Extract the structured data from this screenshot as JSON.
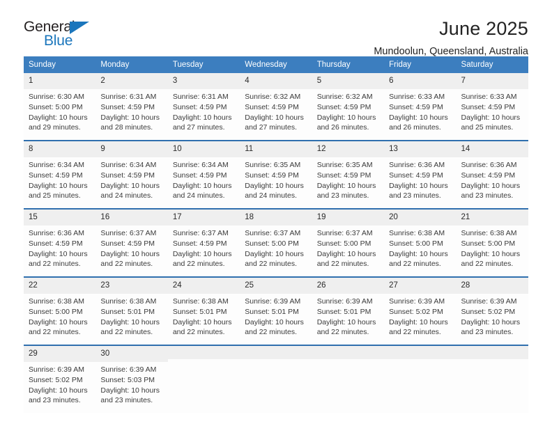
{
  "brand": {
    "name_part1": "General",
    "name_part2": "Blue",
    "accent_color": "#1b76bc",
    "triangle_icon": "triangle-icon"
  },
  "header": {
    "month_title": "June 2025",
    "location": "Mundoolun, Queensland, Australia"
  },
  "calendar": {
    "header_bg": "#3c7ebf",
    "week_divider_color": "#2f6fae",
    "daynum_bg": "#efefef",
    "weekdays": [
      "Sunday",
      "Monday",
      "Tuesday",
      "Wednesday",
      "Thursday",
      "Friday",
      "Saturday"
    ],
    "weeks": [
      [
        {
          "day": "1",
          "sunrise": "Sunrise: 6:30 AM",
          "sunset": "Sunset: 5:00 PM",
          "daylight_line1": "Daylight: 10 hours",
          "daylight_line2": "and 29 minutes."
        },
        {
          "day": "2",
          "sunrise": "Sunrise: 6:31 AM",
          "sunset": "Sunset: 4:59 PM",
          "daylight_line1": "Daylight: 10 hours",
          "daylight_line2": "and 28 minutes."
        },
        {
          "day": "3",
          "sunrise": "Sunrise: 6:31 AM",
          "sunset": "Sunset: 4:59 PM",
          "daylight_line1": "Daylight: 10 hours",
          "daylight_line2": "and 27 minutes."
        },
        {
          "day": "4",
          "sunrise": "Sunrise: 6:32 AM",
          "sunset": "Sunset: 4:59 PM",
          "daylight_line1": "Daylight: 10 hours",
          "daylight_line2": "and 27 minutes."
        },
        {
          "day": "5",
          "sunrise": "Sunrise: 6:32 AM",
          "sunset": "Sunset: 4:59 PM",
          "daylight_line1": "Daylight: 10 hours",
          "daylight_line2": "and 26 minutes."
        },
        {
          "day": "6",
          "sunrise": "Sunrise: 6:33 AM",
          "sunset": "Sunset: 4:59 PM",
          "daylight_line1": "Daylight: 10 hours",
          "daylight_line2": "and 26 minutes."
        },
        {
          "day": "7",
          "sunrise": "Sunrise: 6:33 AM",
          "sunset": "Sunset: 4:59 PM",
          "daylight_line1": "Daylight: 10 hours",
          "daylight_line2": "and 25 minutes."
        }
      ],
      [
        {
          "day": "8",
          "sunrise": "Sunrise: 6:34 AM",
          "sunset": "Sunset: 4:59 PM",
          "daylight_line1": "Daylight: 10 hours",
          "daylight_line2": "and 25 minutes."
        },
        {
          "day": "9",
          "sunrise": "Sunrise: 6:34 AM",
          "sunset": "Sunset: 4:59 PM",
          "daylight_line1": "Daylight: 10 hours",
          "daylight_line2": "and 24 minutes."
        },
        {
          "day": "10",
          "sunrise": "Sunrise: 6:34 AM",
          "sunset": "Sunset: 4:59 PM",
          "daylight_line1": "Daylight: 10 hours",
          "daylight_line2": "and 24 minutes."
        },
        {
          "day": "11",
          "sunrise": "Sunrise: 6:35 AM",
          "sunset": "Sunset: 4:59 PM",
          "daylight_line1": "Daylight: 10 hours",
          "daylight_line2": "and 24 minutes."
        },
        {
          "day": "12",
          "sunrise": "Sunrise: 6:35 AM",
          "sunset": "Sunset: 4:59 PM",
          "daylight_line1": "Daylight: 10 hours",
          "daylight_line2": "and 23 minutes."
        },
        {
          "day": "13",
          "sunrise": "Sunrise: 6:36 AM",
          "sunset": "Sunset: 4:59 PM",
          "daylight_line1": "Daylight: 10 hours",
          "daylight_line2": "and 23 minutes."
        },
        {
          "day": "14",
          "sunrise": "Sunrise: 6:36 AM",
          "sunset": "Sunset: 4:59 PM",
          "daylight_line1": "Daylight: 10 hours",
          "daylight_line2": "and 23 minutes."
        }
      ],
      [
        {
          "day": "15",
          "sunrise": "Sunrise: 6:36 AM",
          "sunset": "Sunset: 4:59 PM",
          "daylight_line1": "Daylight: 10 hours",
          "daylight_line2": "and 22 minutes."
        },
        {
          "day": "16",
          "sunrise": "Sunrise: 6:37 AM",
          "sunset": "Sunset: 4:59 PM",
          "daylight_line1": "Daylight: 10 hours",
          "daylight_line2": "and 22 minutes."
        },
        {
          "day": "17",
          "sunrise": "Sunrise: 6:37 AM",
          "sunset": "Sunset: 4:59 PM",
          "daylight_line1": "Daylight: 10 hours",
          "daylight_line2": "and 22 minutes."
        },
        {
          "day": "18",
          "sunrise": "Sunrise: 6:37 AM",
          "sunset": "Sunset: 5:00 PM",
          "daylight_line1": "Daylight: 10 hours",
          "daylight_line2": "and 22 minutes."
        },
        {
          "day": "19",
          "sunrise": "Sunrise: 6:37 AM",
          "sunset": "Sunset: 5:00 PM",
          "daylight_line1": "Daylight: 10 hours",
          "daylight_line2": "and 22 minutes."
        },
        {
          "day": "20",
          "sunrise": "Sunrise: 6:38 AM",
          "sunset": "Sunset: 5:00 PM",
          "daylight_line1": "Daylight: 10 hours",
          "daylight_line2": "and 22 minutes."
        },
        {
          "day": "21",
          "sunrise": "Sunrise: 6:38 AM",
          "sunset": "Sunset: 5:00 PM",
          "daylight_line1": "Daylight: 10 hours",
          "daylight_line2": "and 22 minutes."
        }
      ],
      [
        {
          "day": "22",
          "sunrise": "Sunrise: 6:38 AM",
          "sunset": "Sunset: 5:00 PM",
          "daylight_line1": "Daylight: 10 hours",
          "daylight_line2": "and 22 minutes."
        },
        {
          "day": "23",
          "sunrise": "Sunrise: 6:38 AM",
          "sunset": "Sunset: 5:01 PM",
          "daylight_line1": "Daylight: 10 hours",
          "daylight_line2": "and 22 minutes."
        },
        {
          "day": "24",
          "sunrise": "Sunrise: 6:38 AM",
          "sunset": "Sunset: 5:01 PM",
          "daylight_line1": "Daylight: 10 hours",
          "daylight_line2": "and 22 minutes."
        },
        {
          "day": "25",
          "sunrise": "Sunrise: 6:39 AM",
          "sunset": "Sunset: 5:01 PM",
          "daylight_line1": "Daylight: 10 hours",
          "daylight_line2": "and 22 minutes."
        },
        {
          "day": "26",
          "sunrise": "Sunrise: 6:39 AM",
          "sunset": "Sunset: 5:01 PM",
          "daylight_line1": "Daylight: 10 hours",
          "daylight_line2": "and 22 minutes."
        },
        {
          "day": "27",
          "sunrise": "Sunrise: 6:39 AM",
          "sunset": "Sunset: 5:02 PM",
          "daylight_line1": "Daylight: 10 hours",
          "daylight_line2": "and 22 minutes."
        },
        {
          "day": "28",
          "sunrise": "Sunrise: 6:39 AM",
          "sunset": "Sunset: 5:02 PM",
          "daylight_line1": "Daylight: 10 hours",
          "daylight_line2": "and 23 minutes."
        }
      ],
      [
        {
          "day": "29",
          "sunrise": "Sunrise: 6:39 AM",
          "sunset": "Sunset: 5:02 PM",
          "daylight_line1": "Daylight: 10 hours",
          "daylight_line2": "and 23 minutes."
        },
        {
          "day": "30",
          "sunrise": "Sunrise: 6:39 AM",
          "sunset": "Sunset: 5:03 PM",
          "daylight_line1": "Daylight: 10 hours",
          "daylight_line2": "and 23 minutes."
        },
        {
          "day": "",
          "sunrise": "",
          "sunset": "",
          "daylight_line1": "",
          "daylight_line2": ""
        },
        {
          "day": "",
          "sunrise": "",
          "sunset": "",
          "daylight_line1": "",
          "daylight_line2": ""
        },
        {
          "day": "",
          "sunrise": "",
          "sunset": "",
          "daylight_line1": "",
          "daylight_line2": ""
        },
        {
          "day": "",
          "sunrise": "",
          "sunset": "",
          "daylight_line1": "",
          "daylight_line2": ""
        },
        {
          "day": "",
          "sunrise": "",
          "sunset": "",
          "daylight_line1": "",
          "daylight_line2": ""
        }
      ]
    ]
  }
}
